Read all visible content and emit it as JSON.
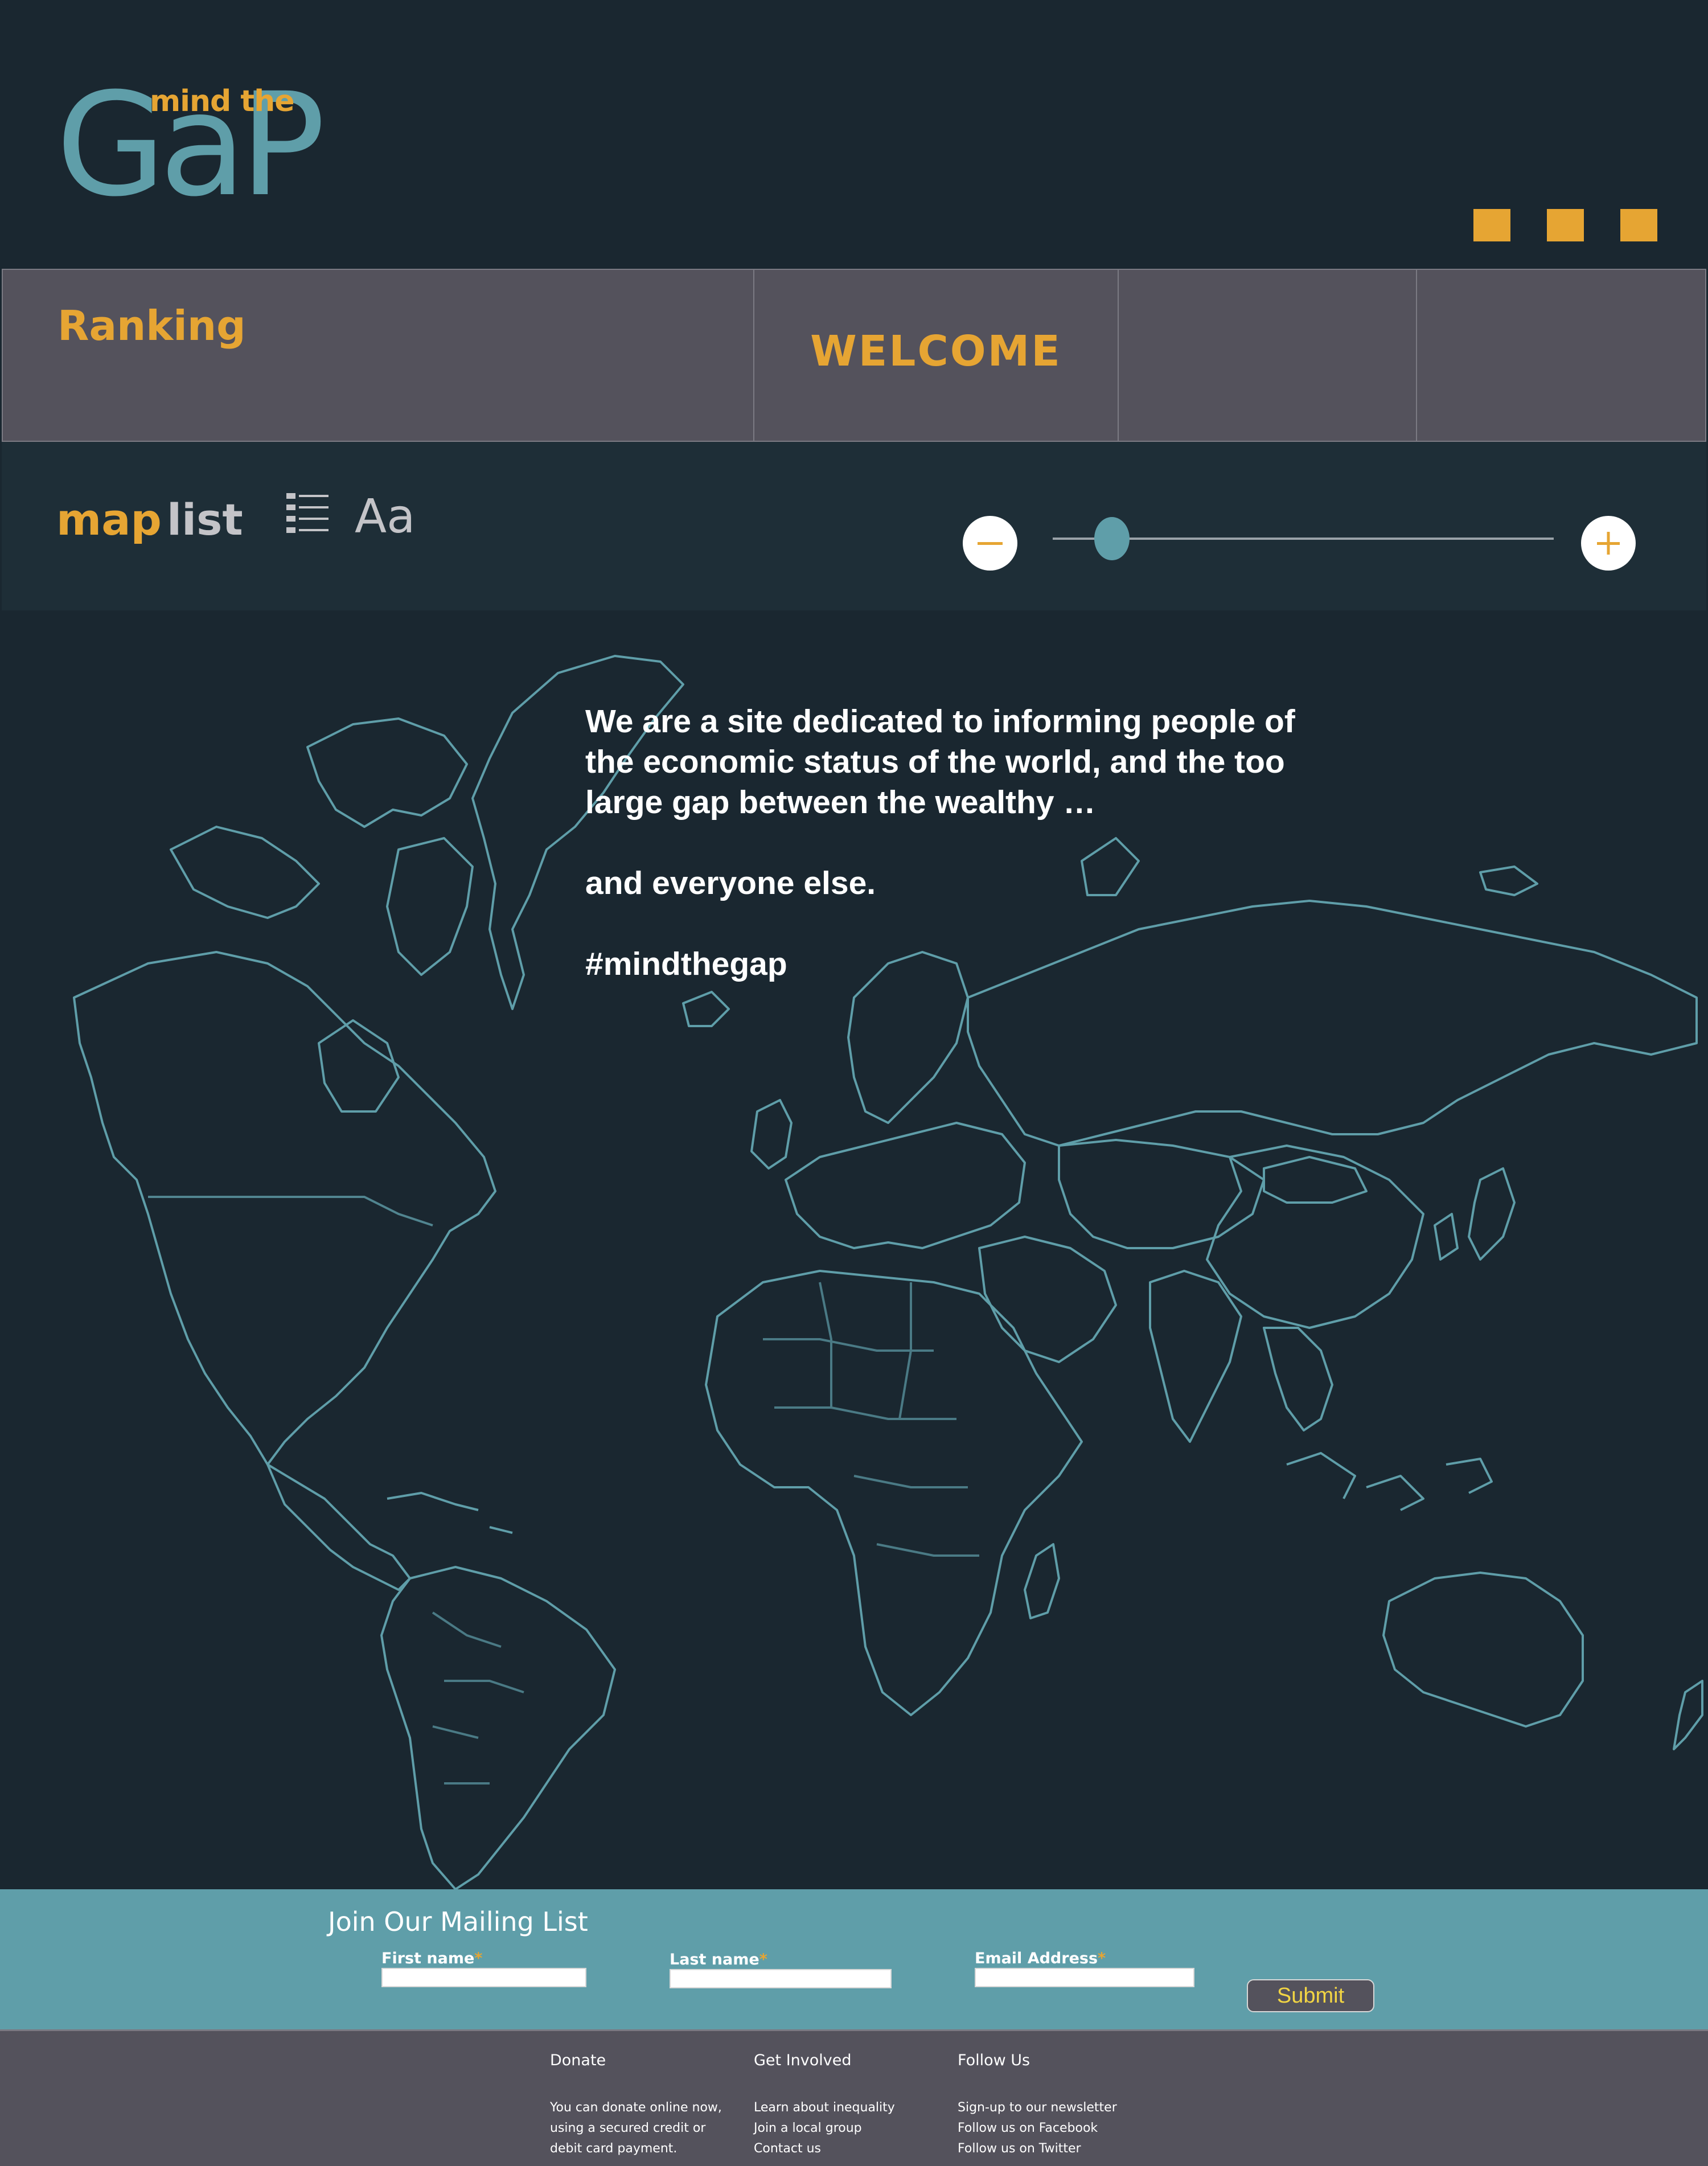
{
  "logo": {
    "small": "mind the",
    "large": "GaP"
  },
  "header": {
    "menu_squares": 3
  },
  "tabs": [
    {
      "label": "Ranking"
    },
    {
      "label": "WELCOME"
    },
    {
      "label": ""
    },
    {
      "label": ""
    }
  ],
  "toolbar": {
    "map_label": "map",
    "list_label": "list",
    "font_label": "Aa",
    "zoom_minus_icon": "minus-icon",
    "zoom_plus_icon": "plus-icon",
    "zoom_level": 0.1
  },
  "intro": {
    "p1": "We are a site dedicated to informing people of the economic status of the world, and the too large gap between the wealthy …",
    "p2": "and everyone else.",
    "p3": "#mindthegap"
  },
  "mailing": {
    "title": "Join Our Mailing List",
    "first_name_label": "First name",
    "last_name_label": "Last name",
    "email_label": "Email Address",
    "required_mark": "*",
    "submit_label": "Submit"
  },
  "footer": {
    "donate": {
      "heading": "Donate",
      "text": "You can donate online now, using a secured credit or debit card payment."
    },
    "get_involved": {
      "heading": "Get Involved",
      "items": [
        "Learn about inequality",
        "Join a local group",
        "Contact us"
      ]
    },
    "follow_us": {
      "heading": "Follow Us",
      "items": [
        "Sign-up to our newsletter",
        "Follow us on Facebook",
        "Follow us on Twitter"
      ]
    }
  },
  "colors": {
    "accent": "#e6a533",
    "teal": "#5f9ea9",
    "background": "#1a2730",
    "panel": "#54525c"
  }
}
